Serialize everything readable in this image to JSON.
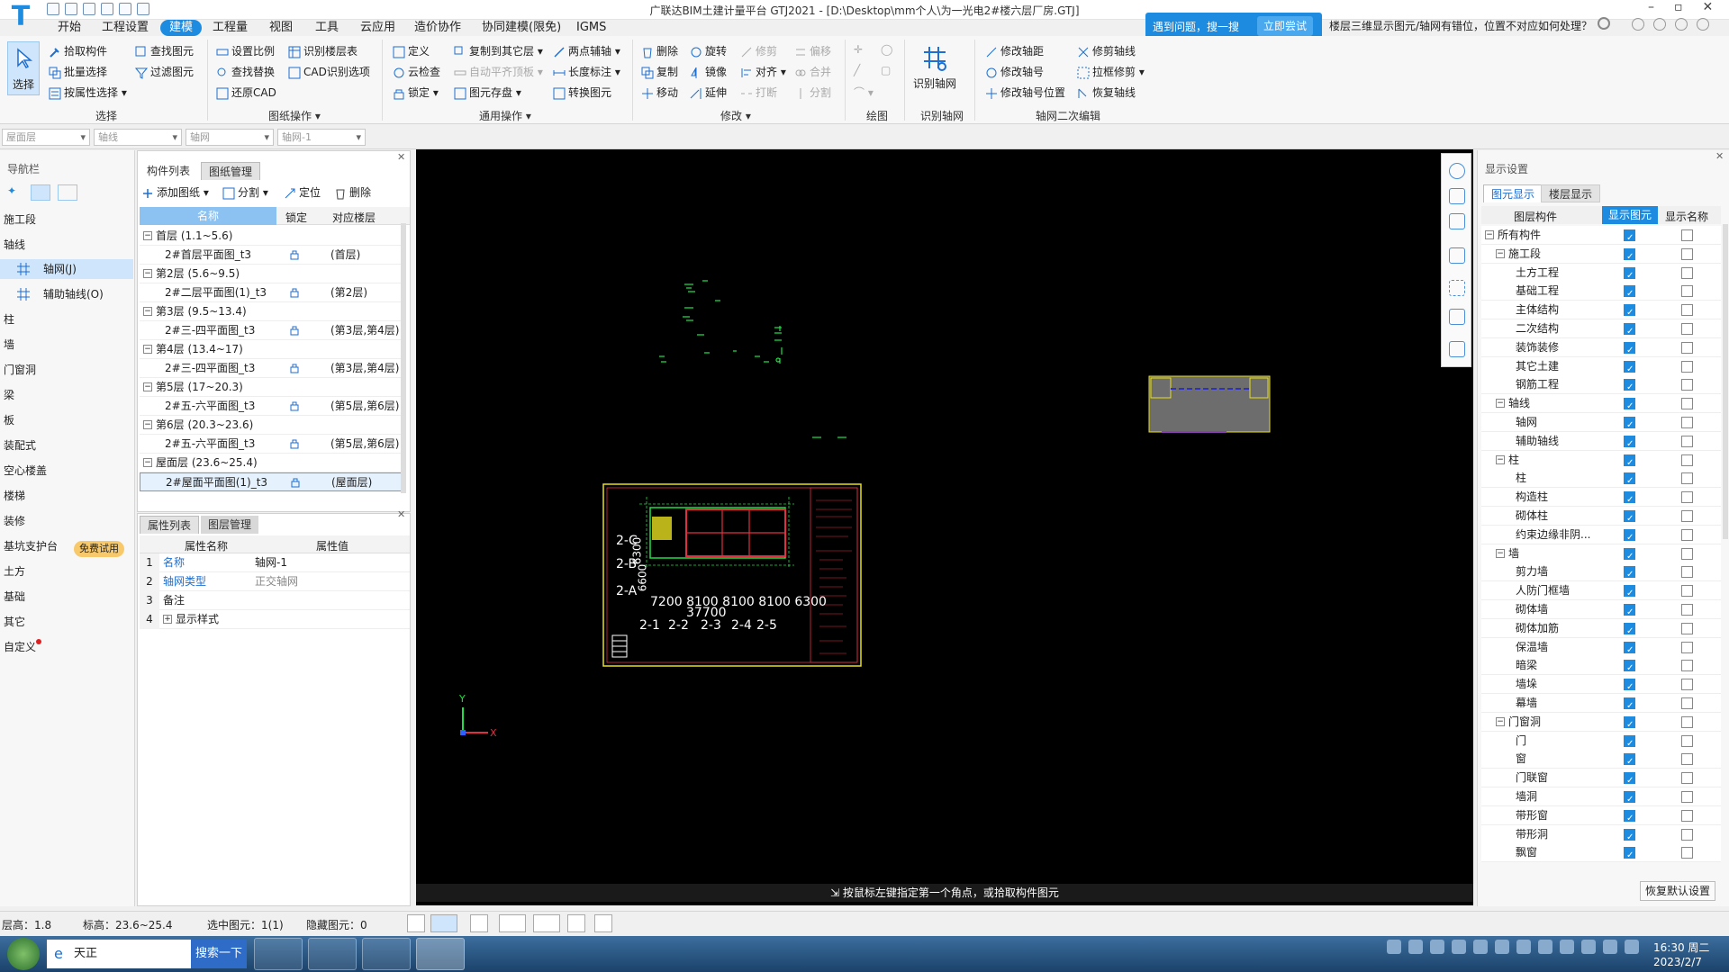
{
  "title_bar": {
    "window_title": "广联达BIM土建计量平台 GTJ2021 - [D:\\Desktop\\mm个人\\为一光电2#楼六层厂房.GTJ]",
    "help_text": "遇到问题，搜一搜",
    "help_button": "立即尝试",
    "faq_text": "楼层三维显示图元/轴网有错位，位置不对应如何处理？"
  },
  "menu": [
    "开始",
    "工程设置",
    "建模",
    "工程量",
    "视图",
    "工具",
    "云应用",
    "造价协作",
    "协同建模(限免)",
    "IGMS"
  ],
  "ribbon": {
    "select_label": "选择",
    "select_items": [
      "拾取构件",
      "批量选择",
      "按属性选择",
      "查找图元",
      "过滤图元"
    ],
    "select_group": "选择",
    "drawing_items": [
      "设置比例",
      "查找替换",
      "还原CAD",
      "识别楼层表",
      "CAD识别选项"
    ],
    "drawing_group": "图纸操作",
    "general_items": [
      "定义",
      "云检查",
      "锁定",
      "复制到其它层",
      "自动平齐顶板",
      "图元存盘",
      "两点辅轴",
      "长度标注",
      "转换图元"
    ],
    "general_group": "通用操作",
    "modify_items": [
      "删除",
      "旋转",
      "修剪",
      "偏移",
      "复制",
      "镜像",
      "对齐",
      "合并",
      "移动",
      "延伸",
      "打断",
      "分割"
    ],
    "modify_group": "修改",
    "draw_group": "绘图",
    "identify_axis_label": "识别轴网",
    "identify_group": "识别轴网",
    "axis_edit_items": [
      "修改轴距",
      "修剪轴线",
      "修改轴号",
      "拉框修剪",
      "修改轴号位置",
      "恢复轴线"
    ],
    "axis_edit_group": "轴网二次编辑"
  },
  "combos": [
    "屋面层",
    "轴线",
    "轴网",
    "轴网-1"
  ],
  "nav": {
    "header": "导航栏",
    "items": [
      "施工段",
      "轴线",
      "轴网(J)",
      "辅助轴线(O)",
      "柱",
      "墙",
      "门窗洞",
      "梁",
      "板",
      "装配式",
      "空心楼盖",
      "楼梯",
      "装修",
      "基坑支护台",
      "土方",
      "基础",
      "其它",
      "自定义"
    ],
    "trial_badge": "免费试用"
  },
  "drawing_panel": {
    "tabs": [
      "构件列表",
      "图纸管理"
    ],
    "tools": [
      "添加图纸",
      "分割",
      "定位",
      "删除"
    ],
    "columns": [
      "名称",
      "锁定",
      "对应楼层"
    ],
    "rows": [
      {
        "type": "group",
        "name": "首层 (1.1~5.6)"
      },
      {
        "type": "item",
        "name": "2#首层平面图_t3",
        "floor": "(首层)"
      },
      {
        "type": "group",
        "name": "第2层 (5.6~9.5)"
      },
      {
        "type": "item",
        "name": "2#二层平面图(1)_t3",
        "floor": "(第2层)"
      },
      {
        "type": "group",
        "name": "第3层 (9.5~13.4)"
      },
      {
        "type": "item",
        "name": "2#三-四平面图_t3",
        "floor": "(第3层,第4层)"
      },
      {
        "type": "group",
        "name": "第4层 (13.4~17)"
      },
      {
        "type": "item",
        "name": "2#三-四平面图_t3",
        "floor": "(第3层,第4层)"
      },
      {
        "type": "group",
        "name": "第5层 (17~20.3)"
      },
      {
        "type": "item",
        "name": "2#五-六平面图_t3",
        "floor": "(第5层,第6层)"
      },
      {
        "type": "group",
        "name": "第6层 (20.3~23.6)"
      },
      {
        "type": "item",
        "name": "2#五-六平面图_t3",
        "floor": "(第5层,第6层)"
      },
      {
        "type": "group",
        "name": "屋面层 (23.6~25.4)"
      },
      {
        "type": "item",
        "name": "2#屋面平面图(1)_t3",
        "floor": "(屋面层)",
        "selected": true
      }
    ]
  },
  "property_panel": {
    "tabs": [
      "属性列表",
      "图层管理"
    ],
    "columns": [
      "属性名称",
      "属性值"
    ],
    "rows": [
      {
        "n": "1",
        "name": "名称",
        "value": "轴网-1"
      },
      {
        "n": "2",
        "name": "轴网类型",
        "value": "正交轴网"
      },
      {
        "n": "3",
        "name": "备注",
        "value": ""
      },
      {
        "n": "4",
        "name": "显示样式",
        "value": ""
      }
    ]
  },
  "canvas": {
    "status_message": "按鼠标左键指定第一个角点，或拾取构件图元",
    "drawing_labels": {
      "row_labels": [
        "2-C",
        "2-B",
        "2-A"
      ],
      "row_dims": "6300",
      "row_dims2": "6600",
      "col_dims": "7200  8100  8100  8100  6300",
      "total_dim": "37700",
      "col_labels": [
        "2-1",
        "2-2",
        "2-3",
        "2-4",
        "2-5"
      ]
    },
    "axis_x": "X",
    "axis_y": "Y"
  },
  "display_settings": {
    "header": "显示设置",
    "tabs": [
      "图元显示",
      "楼层显示"
    ],
    "columns": [
      "图层构件",
      "显示图元",
      "显示名称"
    ],
    "rows": [
      {
        "level": 0,
        "name": "所有构件",
        "show": true,
        "name_show": false
      },
      {
        "level": 1,
        "name": "施工段",
        "show": true,
        "name_show": false
      },
      {
        "level": 2,
        "name": "土方工程",
        "show": true,
        "name_show": false
      },
      {
        "level": 2,
        "name": "基础工程",
        "show": true,
        "name_show": false
      },
      {
        "level": 2,
        "name": "主体结构",
        "show": true,
        "name_show": false
      },
      {
        "level": 2,
        "name": "二次结构",
        "show": true,
        "name_show": false
      },
      {
        "level": 2,
        "name": "装饰装修",
        "show": true,
        "name_show": false
      },
      {
        "level": 2,
        "name": "其它土建",
        "show": true,
        "name_show": false
      },
      {
        "level": 2,
        "name": "钢筋工程",
        "show": true,
        "name_show": false
      },
      {
        "level": 1,
        "name": "轴线",
        "show": true,
        "name_show": false
      },
      {
        "level": 2,
        "name": "轴网",
        "show": true,
        "name_show": false
      },
      {
        "level": 2,
        "name": "辅助轴线",
        "show": true,
        "name_show": false
      },
      {
        "level": 1,
        "name": "柱",
        "show": true,
        "name_show": false
      },
      {
        "level": 2,
        "name": "柱",
        "show": true,
        "name_show": false
      },
      {
        "level": 2,
        "name": "构造柱",
        "show": true,
        "name_show": false
      },
      {
        "level": 2,
        "name": "砌体柱",
        "show": true,
        "name_show": false
      },
      {
        "level": 2,
        "name": "约束边缘非阴...",
        "show": true,
        "name_show": false
      },
      {
        "level": 1,
        "name": "墙",
        "show": true,
        "name_show": false
      },
      {
        "level": 2,
        "name": "剪力墙",
        "show": true,
        "name_show": false
      },
      {
        "level": 2,
        "name": "人防门框墙",
        "show": true,
        "name_show": false
      },
      {
        "level": 2,
        "name": "砌体墙",
        "show": true,
        "name_show": false
      },
      {
        "level": 2,
        "name": "砌体加筋",
        "show": true,
        "name_show": false
      },
      {
        "level": 2,
        "name": "保温墙",
        "show": true,
        "name_show": false
      },
      {
        "level": 2,
        "name": "暗梁",
        "show": true,
        "name_show": false
      },
      {
        "level": 2,
        "name": "墙垛",
        "show": true,
        "name_show": false
      },
      {
        "level": 2,
        "name": "幕墙",
        "show": true,
        "name_show": false
      },
      {
        "level": 1,
        "name": "门窗洞",
        "show": true,
        "name_show": false
      },
      {
        "level": 2,
        "name": "门",
        "show": true,
        "name_show": false
      },
      {
        "level": 2,
        "name": "窗",
        "show": true,
        "name_show": false
      },
      {
        "level": 2,
        "name": "门联窗",
        "show": true,
        "name_show": false
      },
      {
        "level": 2,
        "name": "墙洞",
        "show": true,
        "name_show": false
      },
      {
        "level": 2,
        "name": "带形窗",
        "show": true,
        "name_show": false
      },
      {
        "level": 2,
        "name": "带形洞",
        "show": true,
        "name_show": false
      },
      {
        "level": 2,
        "name": "飘窗",
        "show": true,
        "name_show": false
      }
    ],
    "restore_button": "恢复默认设置"
  },
  "status_bar": {
    "floor_height": "层高：1.8",
    "elevation": "标高：23.6~25.4",
    "selected": "选中图元：1(1)",
    "hidden": "隐藏图元：0"
  },
  "taskbar": {
    "search_text": "天正",
    "search_button": "搜索一下",
    "time": "16:30 周二",
    "date": "2023/2/7"
  },
  "colors": {
    "accent": "#1d8ce0",
    "canvas": "#000000",
    "cad_green": "#22dd44",
    "cad_yellow": "#e8e020",
    "cad_red": "#e03040"
  }
}
